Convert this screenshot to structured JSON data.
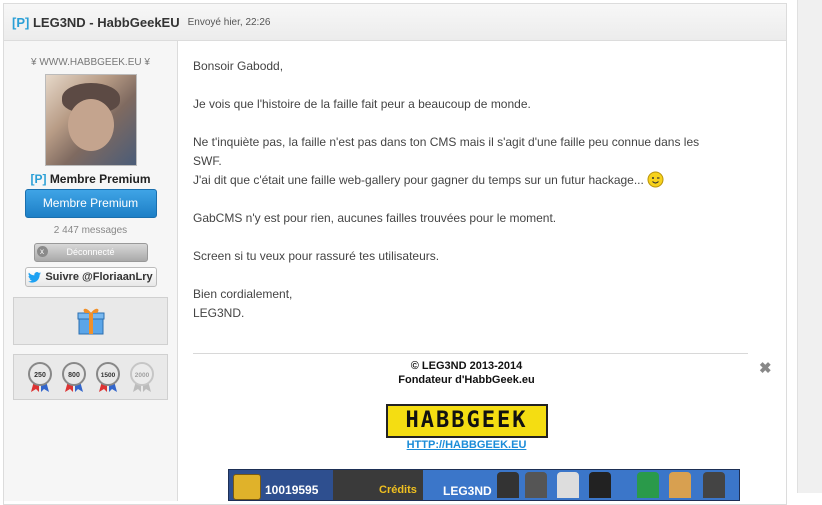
{
  "post": {
    "author_tag": "[P]",
    "author_name": "LEG3ND - HabbGeekEU",
    "date": "Envoyé hier, 22:26"
  },
  "sidebar": {
    "site": "¥ WWW.HABBGEEK.EU ¥",
    "rank_tag": "[P]",
    "rank_name": "Membre Premium",
    "rank_button": "Membre Premium",
    "message_count": "2 447 messages",
    "status": "Déconnecté",
    "status_icon": "x",
    "follow": "Suivre @FloriaanLry",
    "medals": [
      "250",
      "800",
      "1500",
      "2000"
    ]
  },
  "message": {
    "greeting": "Bonsoir Gabodd,",
    "p1": "Je vois que l'histoire de la faille fait peur a beaucoup de monde.",
    "p2a": "Ne t'inquiète pas, la faille n'est pas dans ton CMS mais il s'agit d'une faille peu connue dans les",
    "p2b": "SWF.",
    "p2c": "J'ai dit que c'était une faille web-gallery pour gagner du temps sur un futur hackage...",
    "p3": "GabCMS n'y est pour rien, aucunes failles trouvées pour le moment.",
    "p4": "Screen si tu veux pour rassuré tes utilisateurs.",
    "closing": "Bien cordialement,",
    "sign": "LEG3ND."
  },
  "signature": {
    "close": "✖",
    "copyright": "© LEG3ND 2013-2014",
    "role": "Fondateur d'HabbGeek.eu",
    "logo_text": "HABBGEEK",
    "link": "HTTP://HABBGEEK.EU"
  },
  "banner": {
    "credits_value": "10019595",
    "credits_label": "Crédits",
    "brand": "LEG3ND"
  },
  "colors": {
    "accent": "#2a9fd6",
    "button": "#1d7fc6",
    "logo_bg": "#f4dd12"
  }
}
